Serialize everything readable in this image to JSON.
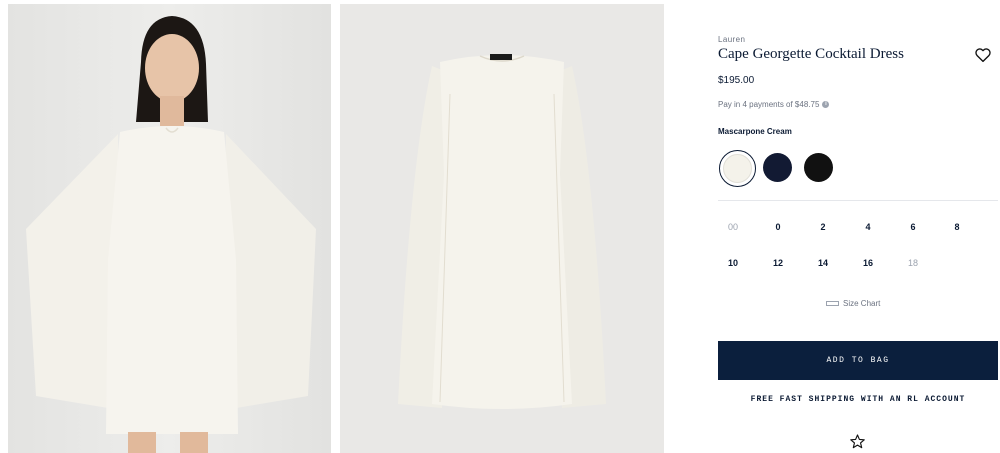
{
  "product": {
    "brand": "Lauren",
    "title": "Cape Georgette Cocktail Dress",
    "price": "$195.00",
    "installments": "Pay in 4 payments of $48.75",
    "color_name": "Mascarpone Cream",
    "icons": {
      "wishlist": "heart-icon",
      "info": "info-icon",
      "ruler": "ruler-icon",
      "favorite": "star-icon"
    }
  },
  "swatches": [
    {
      "name": "Mascarpone Cream",
      "color": "#f4f2ea",
      "selected": true
    },
    {
      "name": "Navy",
      "color": "#121a33",
      "selected": false
    },
    {
      "name": "Black",
      "color": "#111111",
      "selected": false
    }
  ],
  "sizes": [
    {
      "label": "00",
      "available": false
    },
    {
      "label": "0",
      "available": true
    },
    {
      "label": "2",
      "available": true
    },
    {
      "label": "4",
      "available": true
    },
    {
      "label": "6",
      "available": true
    },
    {
      "label": "8",
      "available": true
    },
    {
      "label": "10",
      "available": true
    },
    {
      "label": "12",
      "available": true
    },
    {
      "label": "14",
      "available": true
    },
    {
      "label": "16",
      "available": true
    },
    {
      "label": "18",
      "available": false
    }
  ],
  "size_chart_label": "Size Chart",
  "add_to_bag_label": "ADD TO BAG",
  "shipping_text": "FREE FAST SHIPPING WITH AN RL ACCOUNT",
  "colors": {
    "accent": "#0b1f3d",
    "text": "#0b1a33",
    "muted": "#6b7280"
  }
}
